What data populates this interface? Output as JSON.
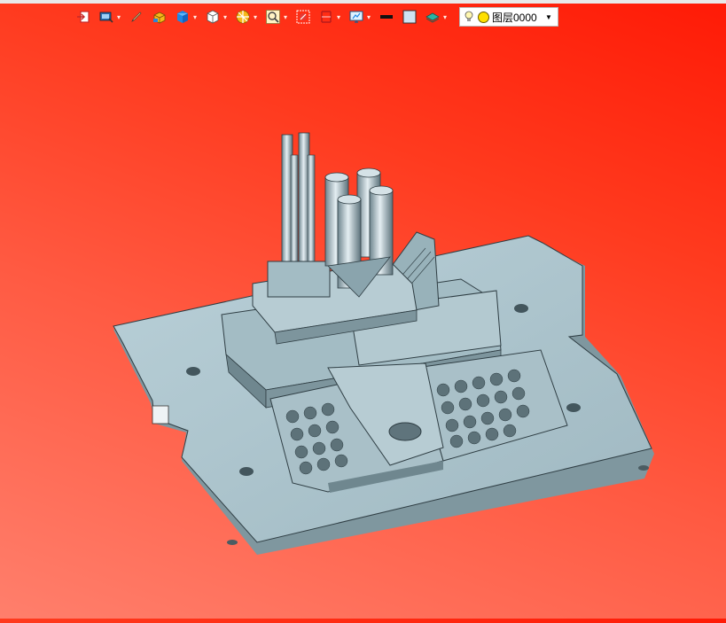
{
  "toolbar": {
    "buttons": [
      {
        "icon": "exit-sketch-icon",
        "has_dropdown": false
      },
      {
        "icon": "display-mode-icon",
        "has_dropdown": true
      },
      {
        "icon": "pen-icon",
        "has_dropdown": false
      },
      {
        "icon": "render-mode-icon",
        "has_dropdown": false
      },
      {
        "icon": "shaded-cube-icon",
        "has_dropdown": true
      },
      {
        "icon": "view-cube-icon",
        "has_dropdown": true
      },
      {
        "icon": "section-view-icon",
        "has_dropdown": true
      },
      {
        "icon": "zoom-fit-icon",
        "has_dropdown": true
      },
      {
        "icon": "zoom-area-icon",
        "has_dropdown": false
      },
      {
        "icon": "clipping-icon",
        "has_dropdown": true
      },
      {
        "icon": "monitor-display-icon",
        "has_dropdown": true
      },
      {
        "icon": "line-style-icon",
        "has_dropdown": false
      },
      {
        "icon": "color-swatch-icon",
        "has_dropdown": false
      },
      {
        "icon": "layer-stack-icon",
        "has_dropdown": true
      }
    ],
    "colors": {
      "accent": "#1e73c8",
      "swatch": "#cfe3f3",
      "yellow": "#f7b81a"
    }
  },
  "layer": {
    "name": "图层0000",
    "visible_icon": "lightbulb-icon",
    "color_icon": "layer-color-dot-icon"
  },
  "viewport": {
    "model": "fixture-assembly-3d-model",
    "background_top": "#ff1a06",
    "background_bottom": "#ff7f6c",
    "part_color": "#a9c3cc"
  }
}
